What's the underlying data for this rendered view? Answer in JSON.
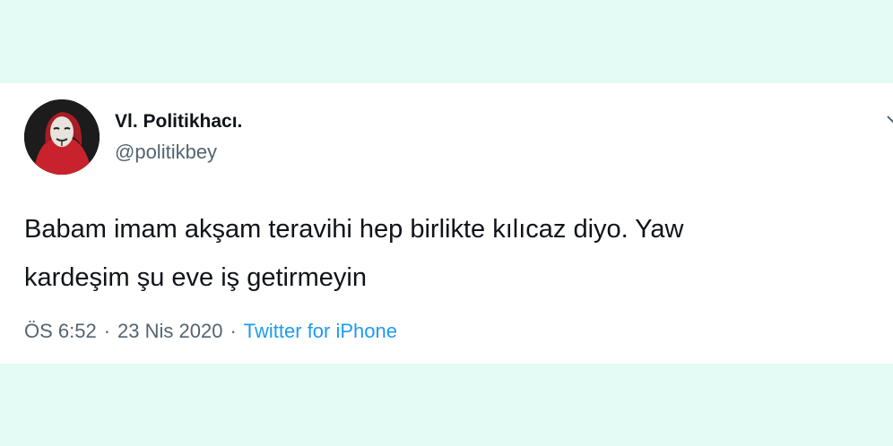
{
  "tweet": {
    "display_name": "Vl. Politikhacı.",
    "handle": "@politikbey",
    "text": "Babam imam akşam teravihi hep birlikte kılıcaz diyo. Yaw\nkardeşim şu eve iş getirmeyin",
    "time": "ÖS 6:52",
    "separator": "·",
    "date": "23 Nis 2020",
    "source": "Twitter for iPhone"
  },
  "colors": {
    "background": "#e3fbf4",
    "card": "#ffffff",
    "text_primary": "#0f1419",
    "text_secondary": "#536471",
    "link": "#1d9bf0",
    "avatar_accent": "#c8232c"
  },
  "icons": {
    "avatar": "profile-photo-masked-figure-red-hood",
    "more": "chevron-down-icon"
  }
}
